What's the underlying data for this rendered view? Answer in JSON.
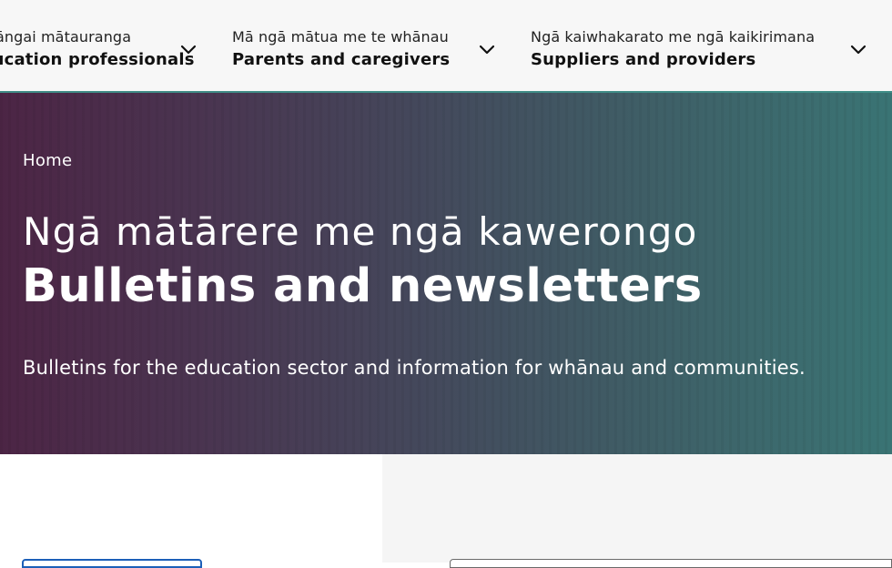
{
  "nav": {
    "items": [
      {
        "sub": "Te rāngai mātauranga",
        "main": "Education professionals",
        "icon": "chevron-down-icon"
      },
      {
        "sub": "Mā ngā mātua me te whānau",
        "main": "Parents and caregivers",
        "icon": "chevron-down-icon"
      },
      {
        "sub": "Ngā kaiwhakarato me ngā kaikirimana",
        "main": "Suppliers and providers",
        "icon": "chevron-down-icon"
      }
    ]
  },
  "hero": {
    "breadcrumb": "Home",
    "title_maori": "Ngā mātārere me ngā kawerongo",
    "title_en": "Bulletins and newsletters",
    "description": "Bulletins for the education sector and information for whānau and communities."
  },
  "colors": {
    "accent_line": "#3f8c86",
    "hero_start": "#4c2545",
    "hero_end": "#3a7474",
    "button_border": "#1c5fb8"
  }
}
